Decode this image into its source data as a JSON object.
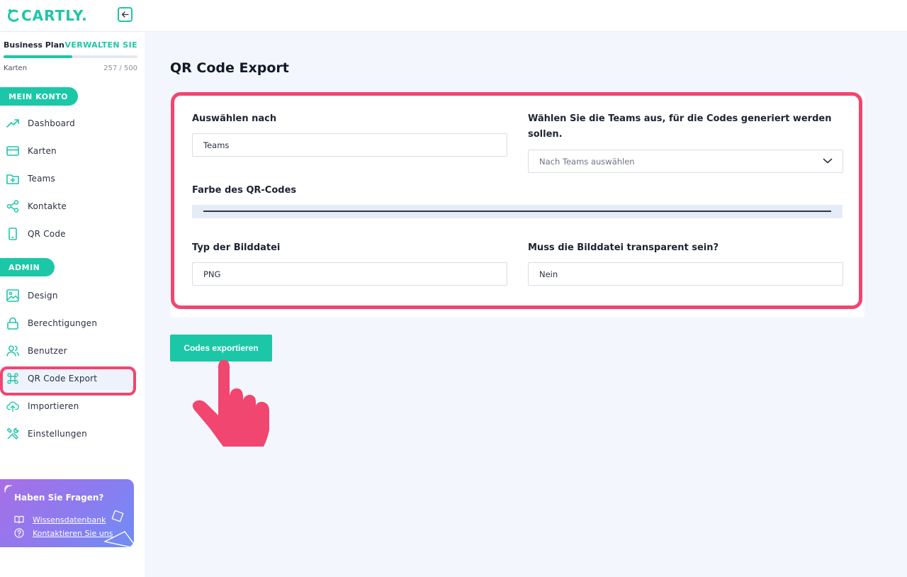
{
  "brand": {
    "logo_text": "CARTLY.",
    "accent": "#1cc7a7",
    "highlight": "#f0466f"
  },
  "plan": {
    "name": "Business Plan",
    "manage_label": "VERWALTEN SIE",
    "usage_label": "Karten",
    "usage_count": "257 / 500",
    "used": 257,
    "total": 500
  },
  "sidebar": {
    "section_account": "MEIN KONTO",
    "account_items": [
      {
        "label": "Dashboard",
        "icon": "trending-up-icon"
      },
      {
        "label": "Karten",
        "icon": "credit-card-icon"
      },
      {
        "label": "Teams",
        "icon": "folder-plus-icon"
      },
      {
        "label": "Kontakte",
        "icon": "share-icon"
      },
      {
        "label": "QR Code",
        "icon": "smartphone-icon"
      }
    ],
    "section_admin": "ADMIN",
    "admin_items": [
      {
        "label": "Design",
        "icon": "image-icon"
      },
      {
        "label": "Berechtigungen",
        "icon": "lock-icon"
      },
      {
        "label": "Benutzer",
        "icon": "users-icon"
      },
      {
        "label": "QR Code Export",
        "icon": "command-icon",
        "active": true
      },
      {
        "label": "Importieren",
        "icon": "upload-cloud-icon"
      },
      {
        "label": "Einstellungen",
        "icon": "tools-icon"
      }
    ]
  },
  "help": {
    "title": "Haben Sie Fragen?",
    "knowledge_base": "Wissensdatenbank",
    "contact": "Kontaktieren Sie uns"
  },
  "main": {
    "title": "QR Code Export",
    "select_by_label": "Auswählen nach",
    "select_by_value": "Teams",
    "teams_label": "Wählen Sie die Teams aus, für die Codes generiert werden sollen.",
    "teams_placeholder": "Nach Teams auswählen",
    "color_label": "Farbe des QR-Codes",
    "color_value": "#333845",
    "filetype_label": "Typ der Bilddatei",
    "filetype_value": "PNG",
    "transparent_label": "Muss die Bilddatei transparent sein?",
    "transparent_value": "Nein",
    "export_button": "Codes exportieren"
  }
}
